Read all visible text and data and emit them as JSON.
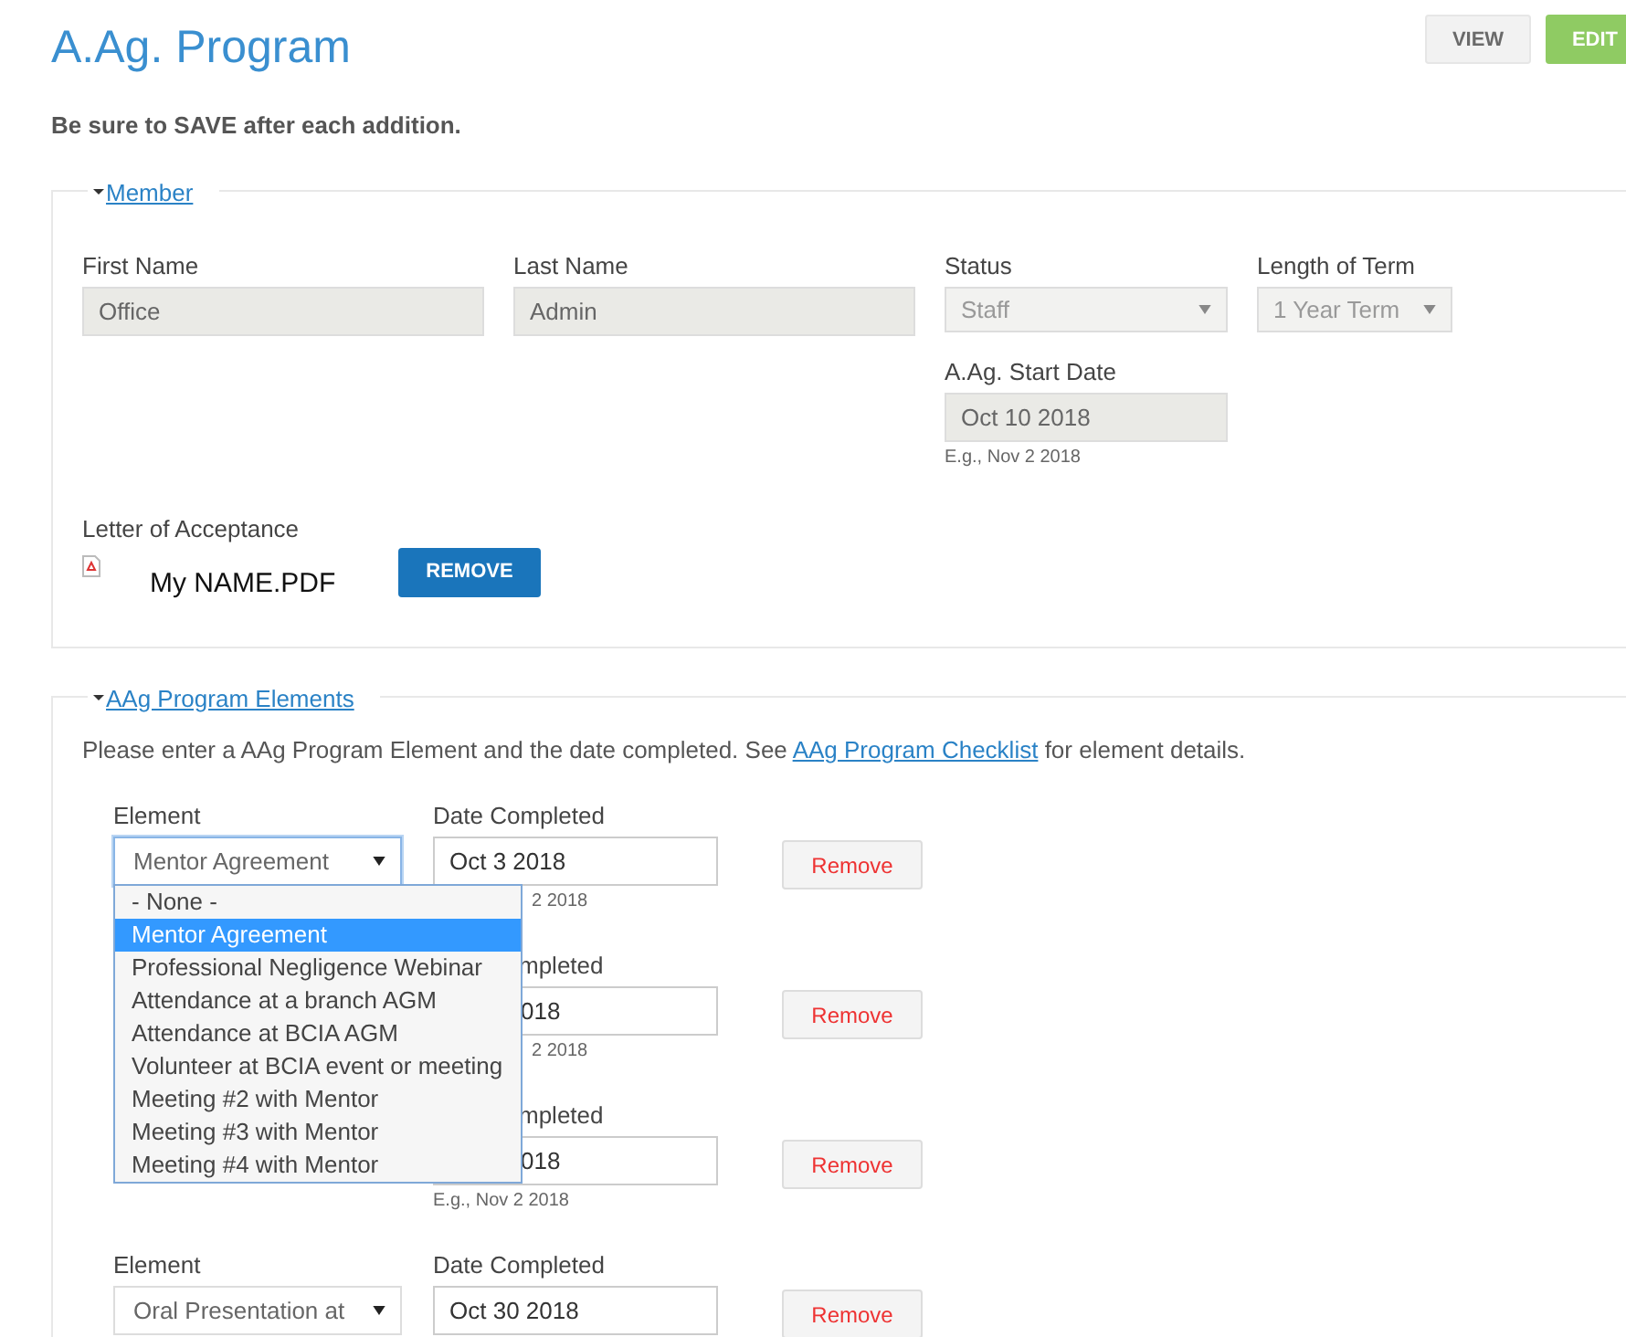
{
  "header": {
    "title": "A.Ag. Program",
    "buttons": [
      {
        "label": "VIEW",
        "selected": false
      },
      {
        "label": "EDIT",
        "selected": true
      }
    ]
  },
  "notice": "Be sure to SAVE after each addition.",
  "member": {
    "legend": "Member",
    "expanded": true,
    "fields": [
      {
        "kind": "text",
        "label": "First Name",
        "value": "Office"
      },
      {
        "kind": "text",
        "label": "Last Name",
        "value": "Admin"
      },
      {
        "kind": "select",
        "label": "Status",
        "value": "Staff"
      },
      {
        "kind": "select",
        "label": "Length of Term",
        "value": "1 Year Term"
      },
      {
        "kind": "date",
        "label": "A.Ag. Start Date",
        "value": "Oct 10 2018",
        "hint": "E.g., Nov 2 2018"
      }
    ],
    "letter": {
      "label": "Letter of Acceptance",
      "file": "My NAME.PDF",
      "button": "REMOVE"
    }
  },
  "elements": {
    "legend": "AAg Program Elements",
    "expanded": true,
    "intro_before": "Please enter a AAg Program Element and the date completed. See ",
    "intro_link": "AAg Program Checklist",
    "intro_after": " for element details.",
    "rows": [
      {
        "kind": "open",
        "element_label": "Element",
        "element_value": "Mentor Agreement",
        "focused": true,
        "date_label": "Date Completed",
        "date_value": "Oct 3 2018",
        "hint": "2 2018",
        "hint_covered": true,
        "button": "Remove"
      },
      {
        "kind": "covered",
        "date_label": "mpleted",
        "date_value": "018",
        "hint": "2 2018",
        "hint_covered": true,
        "button": "Remove"
      },
      {
        "kind": "covered",
        "date_label": "mpleted",
        "date_value": "018",
        "hint": "E.g., Nov 2 2018",
        "hint_covered": false,
        "button": "Remove"
      },
      {
        "kind": "open",
        "element_label": "Element",
        "element_value": "Oral Presentation at",
        "focused": false,
        "date_label": "Date Completed",
        "date_value": "Oct 30 2018",
        "button": "Remove"
      }
    ],
    "menu": {
      "options": [
        {
          "label": "- None -",
          "selected": false
        },
        {
          "label": "Mentor Agreement",
          "selected": true
        },
        {
          "label": "Professional Negligence Webinar",
          "selected": false
        },
        {
          "label": "Attendance at a branch AGM",
          "selected": false
        },
        {
          "label": "Attendance at BCIA AGM",
          "selected": false
        },
        {
          "label": "Volunteer at BCIA event or meeting",
          "selected": false
        },
        {
          "label": "Meeting #2 with Mentor",
          "selected": false
        },
        {
          "label": "Meeting #3 with Mentor",
          "selected": false
        },
        {
          "label": "Meeting #4 with Mentor",
          "selected": false
        }
      ]
    }
  }
}
